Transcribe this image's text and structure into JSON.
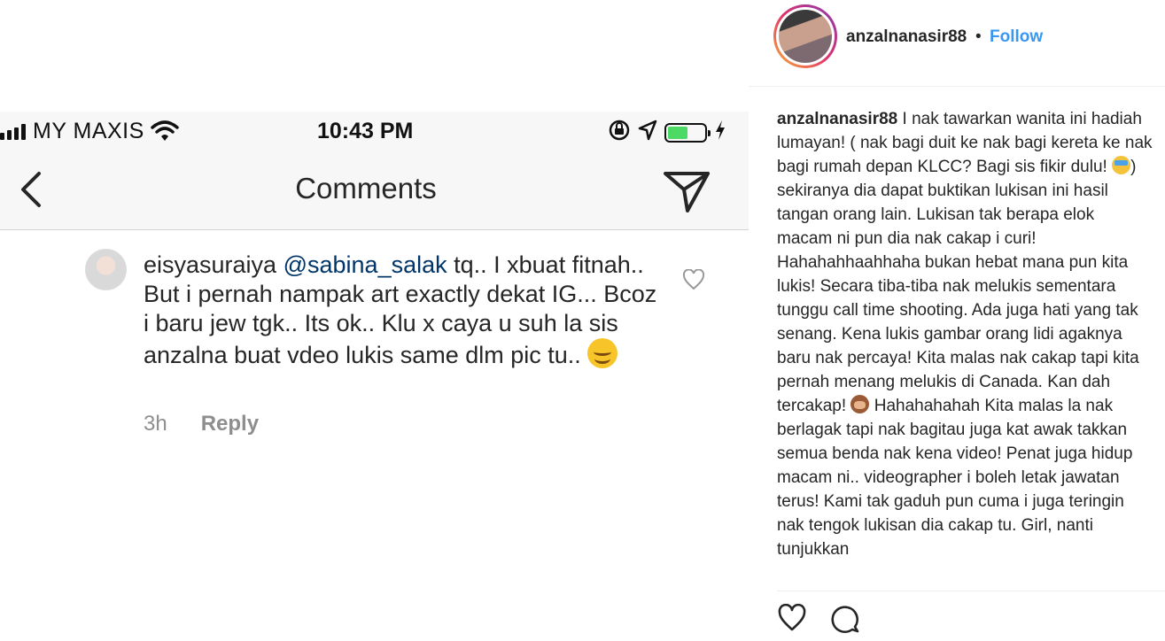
{
  "screenshot": {
    "statusbar": {
      "carrier": "MY MAXIS",
      "time": "10:43 PM",
      "icons": [
        "signal-bars-icon",
        "wifi-icon",
        "rotation-lock-icon",
        "location-arrow-icon",
        "battery-icon",
        "charging-bolt-icon"
      ]
    },
    "navbar": {
      "title": "Comments",
      "back_icon": "chevron-left-icon",
      "share_icon": "paper-plane-icon"
    },
    "comment": {
      "username": "eisyasuraiya",
      "mention": "@sabina_salak",
      "text": " tq.. I xbuat fitnah.. But i pernah nampak art exactly dekat IG... Bcoz i baru jew tgk.. Its ok.. Klu x caya u suh la sis anzalna buat vdeo lukis same dlm pic tu.. ",
      "emoji": "smiling-face-emoji",
      "age": "3h",
      "reply_label": "Reply",
      "like_icon": "heart-outline-icon"
    }
  },
  "panel": {
    "header": {
      "username": "anzalnanasir88",
      "separator": "•",
      "follow_label": "Follow"
    },
    "caption": {
      "username": "anzalnanasir88",
      "part1": " I nak tawarkan wanita ini hadiah lumayan! ( nak bagi duit ke nak bagi kereta ke nak bagi rumah depan KLCC? Bagi sis fikir dulu! ",
      "emoji1": "face-with-medical-mask-emoji",
      "part2": ") sekiranya dia dapat buktikan lukisan ini hasil tangan orang lain. Lukisan tak berapa elok macam ni pun dia nak cakap i curi! Hahahahhaahhaha bukan hebat mana pun kita lukis! Secara tiba-tiba nak melukis sementara tunggu call time shooting. Ada juga hati yang tak senang. Kena lukis gambar orang lidi agaknya baru nak percaya! Kita malas nak cakap tapi kita pernah menang melukis di Canada. Kan dah tercakap! ",
      "emoji2": "see-no-evil-monkey-emoji",
      "part3": " Hahahahahah Kita malas la nak berlagak tapi nak bagitau juga kat awak takkan semua benda nak kena video! Penat juga hidup macam ni.. videographer i boleh letak jawatan terus! Kami tak gaduh pun cuma i juga teringin nak tengok lukisan dia cakap tu. Girl, nanti tunjukkan"
    },
    "actions": {
      "like_icon": "heart-outline-icon",
      "comment_icon": "comment-bubble-icon"
    }
  }
}
